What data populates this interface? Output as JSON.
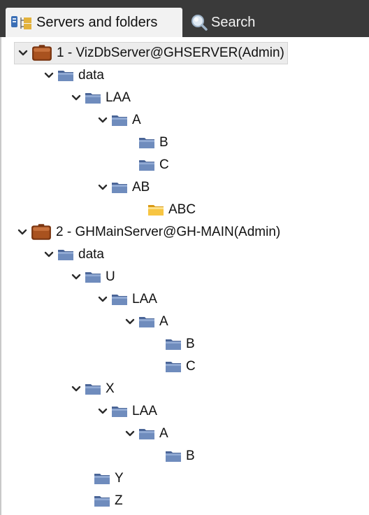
{
  "tabs": [
    {
      "label": "Servers and folders",
      "active": true,
      "icon": "servers-folders-icon"
    },
    {
      "label": "Search",
      "active": false,
      "icon": "search-icon"
    }
  ],
  "colors": {
    "tabbar_bg": "#3a3a3a",
    "active_tab_bg": "#f2f2f2",
    "folder_blue": "#5c7aaa",
    "folder_yellow": "#f4bd2a",
    "server_brown": "#8b3e12",
    "chevron": "#2b2b2b"
  },
  "tree": {
    "servers": [
      {
        "label": "1 - VizDbServer@GHSERVER(Admin)",
        "selected": true,
        "folders": {
          "data": {
            "label": "data"
          },
          "laa": {
            "label": "LAA"
          },
          "a": {
            "label": "A"
          },
          "b": {
            "label": "B"
          },
          "c": {
            "label": "C"
          },
          "ab": {
            "label": "AB"
          },
          "abc": {
            "label": "ABC"
          }
        }
      },
      {
        "label": "2 - GHMainServer@GH-MAIN(Admin)",
        "selected": false,
        "folders": {
          "data": {
            "label": "data"
          },
          "u": {
            "label": "U"
          },
          "u_laa": {
            "label": "LAA"
          },
          "u_a": {
            "label": "A"
          },
          "u_b": {
            "label": "B"
          },
          "u_c": {
            "label": "C"
          },
          "x": {
            "label": "X"
          },
          "x_laa": {
            "label": "LAA"
          },
          "x_a": {
            "label": "A"
          },
          "x_b": {
            "label": "B"
          },
          "y": {
            "label": "Y"
          },
          "z": {
            "label": "Z"
          }
        }
      }
    ]
  }
}
